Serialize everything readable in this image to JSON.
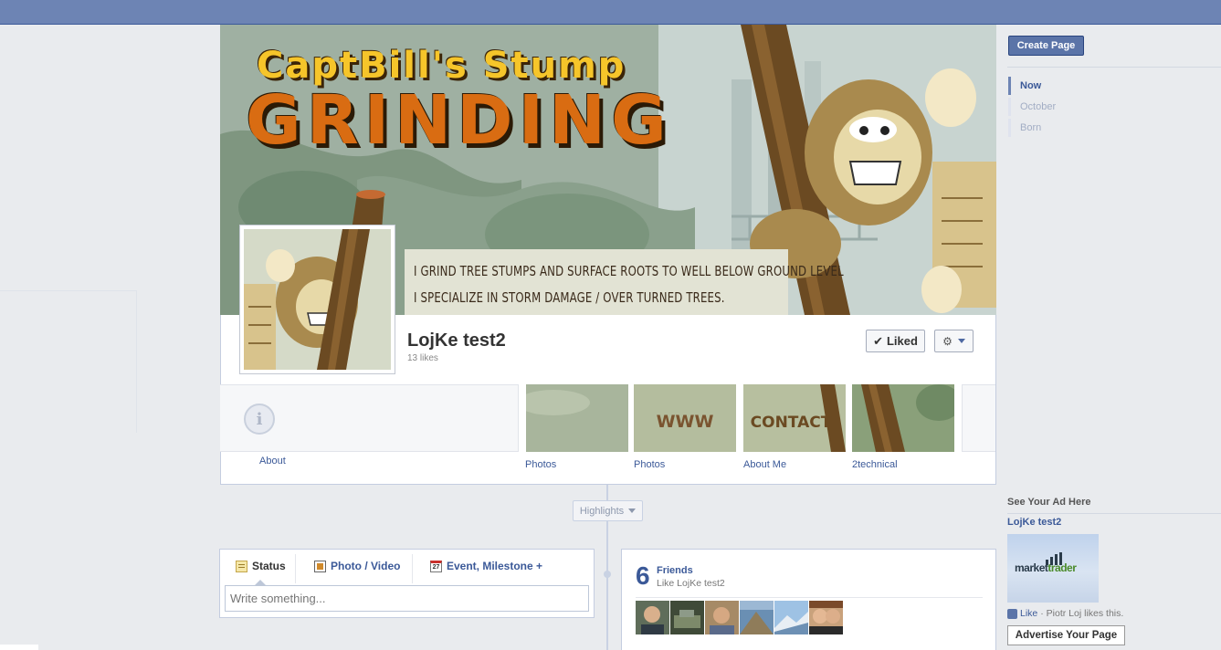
{
  "cover": {
    "title_line1": "CaptBill's Stump",
    "title_line2": "GRINDING",
    "tagline_1": "I GRIND TREE STUMPS AND SURFACE ROOTS TO WELL BELOW GROUND LEVEL",
    "tagline_2": "I SPECIALIZE IN STORM DAMAGE / OVER TURNED TREES."
  },
  "page": {
    "name": "LojKe test2",
    "likes": "13 likes",
    "liked_label": "Liked"
  },
  "apps": {
    "about": "About",
    "tiles": [
      {
        "label": "Photos",
        "tile_text": ""
      },
      {
        "label": "Photos",
        "tile_text": "WWW"
      },
      {
        "label": "About Me",
        "tile_text": "CONTACT"
      },
      {
        "label": "2technical",
        "tile_text": ""
      }
    ]
  },
  "timeline": {
    "highlights": "Highlights"
  },
  "composer": {
    "tab_status": "Status",
    "tab_photo": "Photo / Video",
    "tab_event": "Event, Milestone +",
    "cal_day": "27",
    "placeholder": "Write something..."
  },
  "friends": {
    "count": "6",
    "title": "Friends",
    "subtitle": "Like LojKe test2"
  },
  "sidebar": {
    "create_page": "Create Page",
    "scrubber": [
      "Now",
      "October",
      "Born"
    ],
    "ad_heading": "See Your Ad Here",
    "ad_title": "LojKe test2",
    "ad_logo_a": "market",
    "ad_logo_b": "trader",
    "ad_like": "Like",
    "ad_like_text": "· Piotr Loj likes this.",
    "advertise": "Advertise Your Page"
  },
  "colors": {
    "topbar": "#6d84b4",
    "link": "#3b5998",
    "cover_orange": "#d96c12",
    "cover_yellow": "#f6c52a",
    "trunk_brown": "#6b4a22"
  }
}
